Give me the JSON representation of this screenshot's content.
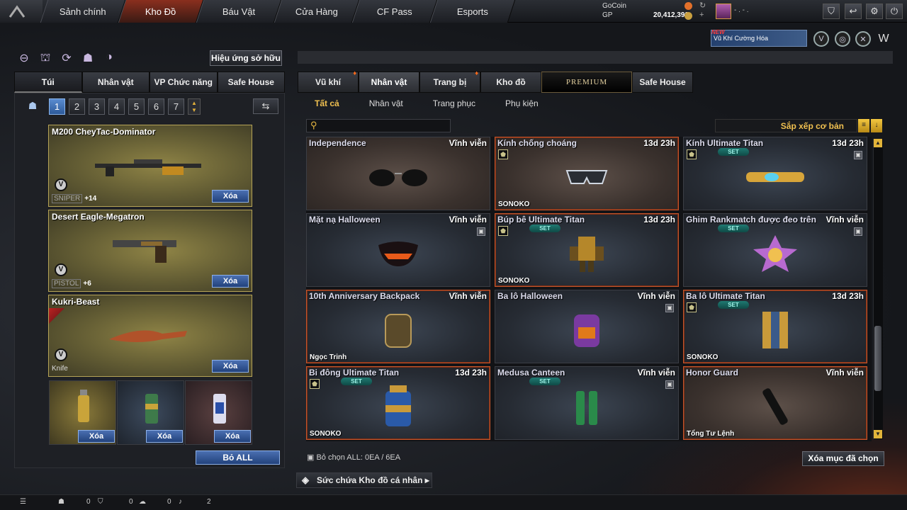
{
  "nav": {
    "tabs": [
      "Sảnh chính",
      "Kho Đồ",
      "Báu Vật",
      "Cửa Hàng",
      "CF Pass",
      "Esports"
    ],
    "active": 1
  },
  "currency": {
    "gocoin_label": "GoCoin",
    "gocoin_value": "0",
    "gp_label": "GP",
    "gp_value": "20,412,390"
  },
  "user": {
    "name": "- . - ."
  },
  "banner": {
    "new": "NEW",
    "text": "Vũ Khí Cường Hóa"
  },
  "left": {
    "effects_button": "Hiệu ứng sở hữu",
    "tabs": [
      "Túi",
      "Nhân vật",
      "VP Chức năng",
      "Safe House"
    ],
    "pages": [
      "1",
      "2",
      "3",
      "4",
      "5",
      "6",
      "7"
    ],
    "weapons": [
      {
        "name": "M200 CheyTac-Dominator",
        "type": "SNIPER",
        "plus": "+14",
        "delete": "Xóa"
      },
      {
        "name": "Desert Eagle-Megatron",
        "type": "PISTOL",
        "plus": "+6",
        "delete": "Xóa"
      },
      {
        "name": "Kukri-Beast",
        "type": "Knife",
        "plus": "",
        "delete": "Xóa"
      }
    ],
    "grenades": [
      {
        "delete": "Xóa"
      },
      {
        "delete": "Xóa"
      },
      {
        "delete": "Xóa"
      }
    ],
    "clear_all": "Bỏ ALL"
  },
  "right": {
    "tabs": [
      "Vũ khí",
      "Nhân vật",
      "Trang bị",
      "Kho đồ",
      "PREMIUM",
      "Safe House"
    ],
    "subtabs": [
      "Tất cả",
      "Nhân vật",
      "Trang phục",
      "Phụ kiện"
    ],
    "sort": "Sắp xếp cơ bản",
    "items": [
      {
        "name": "Independence",
        "duration": "Vĩnh viễn",
        "owner": "",
        "set": false
      },
      {
        "name": "Kính chống choáng",
        "duration": "13d 23h",
        "owner": "SONOKO",
        "set": false
      },
      {
        "name": "Kính Ultimate Titan",
        "duration": "13d 23h",
        "owner": "",
        "set": true
      },
      {
        "name": "Mặt nạ Halloween",
        "duration": "Vĩnh viễn",
        "owner": "",
        "set": false
      },
      {
        "name": "Búp bê Ultimate Titan",
        "duration": "13d 23h",
        "owner": "SONOKO",
        "set": true
      },
      {
        "name": "Ghim Rankmatch được đeo trên",
        "duration": "Vĩnh viễn",
        "owner": "",
        "set": true
      },
      {
        "name": "10th Anniversary Backpack",
        "duration": "Vĩnh viễn",
        "owner": "Ngọc Trinh",
        "set": false
      },
      {
        "name": "Ba lô Halloween",
        "duration": "Vĩnh viễn",
        "owner": "",
        "set": false
      },
      {
        "name": "Ba lô Ultimate Titan",
        "duration": "13d 23h",
        "owner": "SONOKO",
        "set": true
      },
      {
        "name": "Bi đông Ultimate Titan",
        "duration": "13d 23h",
        "owner": "SONOKO",
        "set": true
      },
      {
        "name": "Medusa Canteen",
        "duration": "Vĩnh viễn",
        "owner": "",
        "set": true
      },
      {
        "name": "Honor Guard",
        "duration": "Vĩnh viễn",
        "owner": "Tổng Tư Lệnh",
        "set": false
      }
    ],
    "set_label": "SET",
    "deselect_all": "Bỏ chọn ALL: 0EA / 6EA",
    "delete_selected": "Xóa mục đã chọn",
    "capacity": "Sức chứa Kho đồ cá nhân"
  },
  "bottom": {
    "count1": "0",
    "count2": "0",
    "count3": "0",
    "count4": "2"
  }
}
